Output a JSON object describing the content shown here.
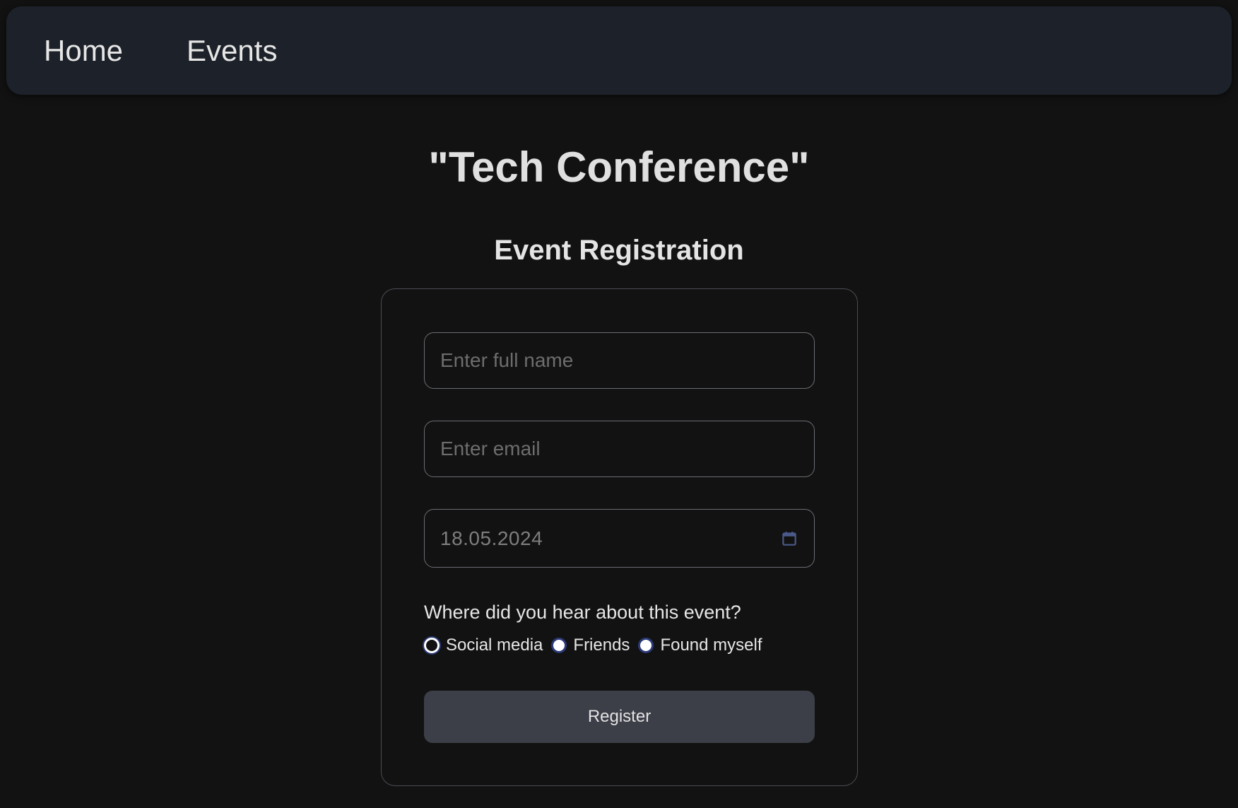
{
  "nav": {
    "items": [
      {
        "label": "Home"
      },
      {
        "label": "Events"
      }
    ]
  },
  "page": {
    "title": "\"Tech Conference\"",
    "section_title": "Event Registration"
  },
  "form": {
    "name_placeholder": "Enter full name",
    "email_placeholder": "Enter email",
    "date_value": "18.05.2024",
    "question": "Where did you hear about this event?",
    "options": [
      {
        "label": "Social media",
        "state": "focused"
      },
      {
        "label": "Friends",
        "state": "unselected"
      },
      {
        "label": "Found myself",
        "state": "unselected"
      }
    ],
    "submit_label": "Register"
  },
  "icons": {
    "calendar": "calendar-icon"
  },
  "colors": {
    "background": "#121212",
    "navbar": "#1d222a",
    "button": "#3c3e48",
    "radio_accent": "#2b3a78",
    "calendar_icon": "#4a5a8a"
  }
}
